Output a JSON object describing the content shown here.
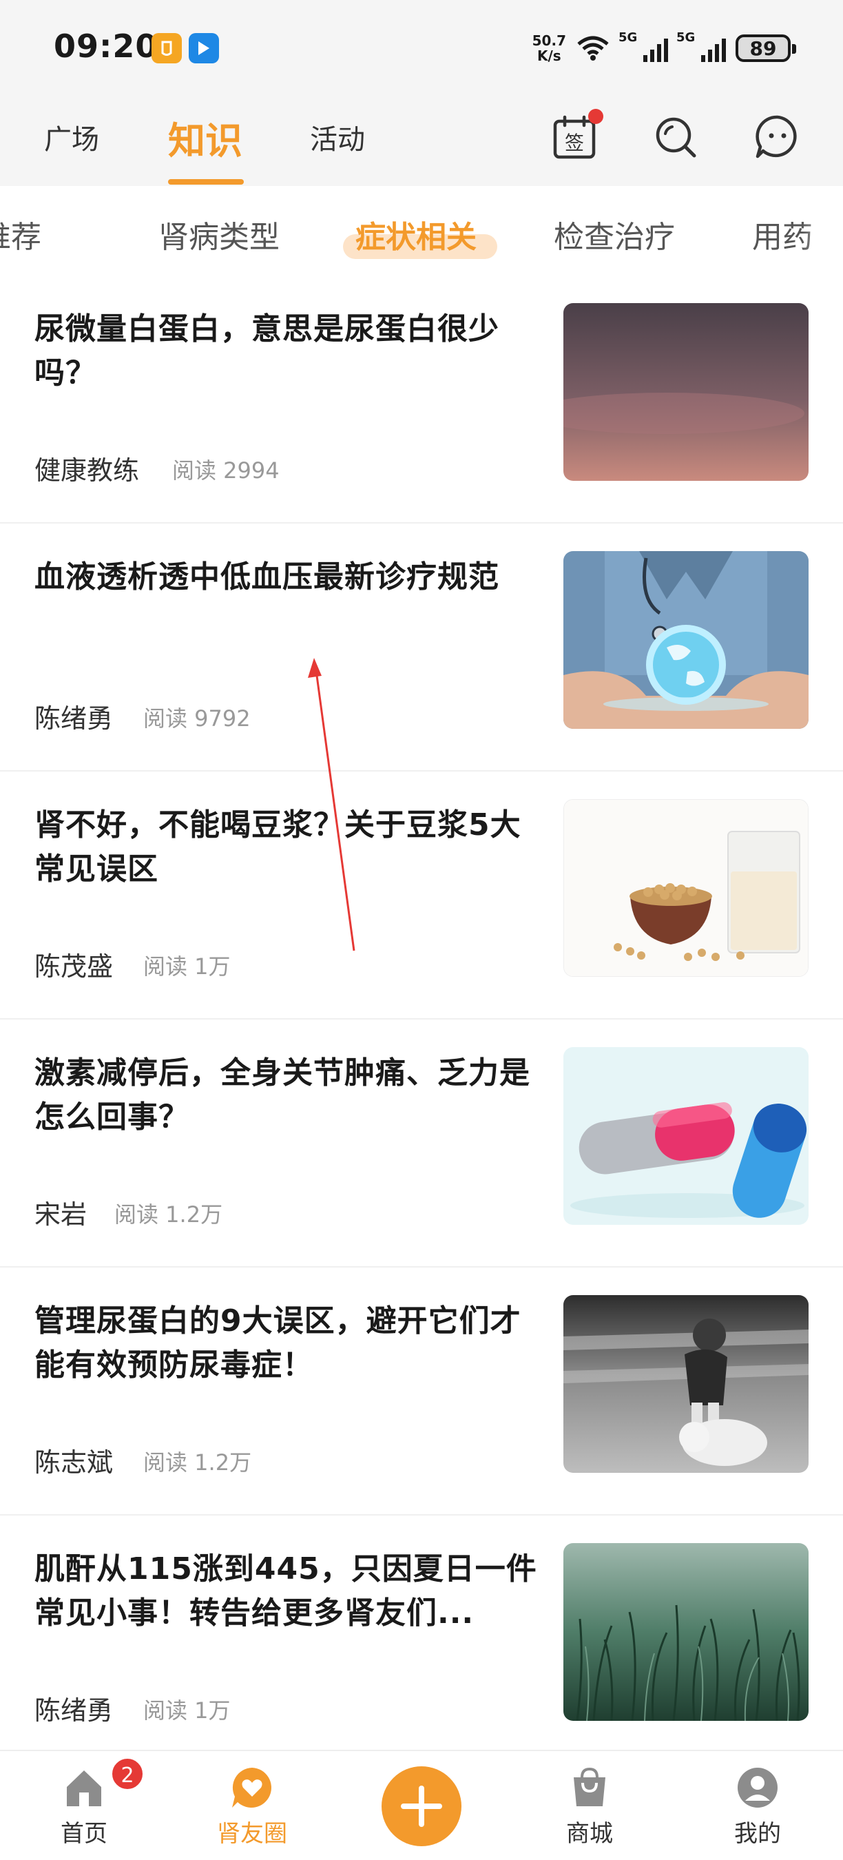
{
  "status_bar": {
    "time": "09:20",
    "net_speed_value": "50.7",
    "net_speed_unit": "K/s",
    "signal1_label": "5G",
    "signal2_label": "5G",
    "battery": "89"
  },
  "top_nav": {
    "tabs": [
      {
        "label": "广场"
      },
      {
        "label": "知识"
      },
      {
        "label": "活动"
      }
    ],
    "active_tab": "知识",
    "sign_icon_text": "签",
    "accent_color": "#f39a2c"
  },
  "category_tabs": {
    "items": [
      {
        "label": "推荐"
      },
      {
        "label": "肾病类型"
      },
      {
        "label": "症状相关"
      },
      {
        "label": "检查治疗"
      },
      {
        "label": "用药"
      }
    ],
    "active": "症状相关"
  },
  "articles": [
    {
      "title": "尿微量白蛋白，意思是尿蛋白很少吗？",
      "author": "健康教练",
      "reads": "阅读 2994",
      "image": "crescent-moon-dusk"
    },
    {
      "title": "血液透析透中低血压最新诊疗规范",
      "author": "陈绪勇",
      "reads": "阅读 9792",
      "image": "doctor-holding-globe"
    },
    {
      "title": "肾不好，不能喝豆浆？关于豆浆5大常见误区",
      "author": "陈茂盛",
      "reads": "阅读 1万",
      "image": "soybeans-and-soymilk"
    },
    {
      "title": "激素减停后，全身关节肿痛、乏力是怎么回事？",
      "author": "宋岩",
      "reads": "阅读 1.2万",
      "image": "medicine-capsules"
    },
    {
      "title": "管理尿蛋白的9大误区，避开它们才能有效预防尿毒症！",
      "author": "陈志斌",
      "reads": "阅读 1.2万",
      "image": "girl-with-dog-bw"
    },
    {
      "title": "肌酐从115涨到445，只因夏日一件常见小事！转告给更多肾友们...",
      "author": "陈绪勇",
      "reads": "阅读 1万",
      "image": "green-grass"
    }
  ],
  "bottom_nav": {
    "items": [
      {
        "label": "首页",
        "icon": "home-icon",
        "badge": "2"
      },
      {
        "label": "肾友圈",
        "icon": "heart-chat-icon"
      },
      {
        "label": "",
        "icon": "plus-icon"
      },
      {
        "label": "商城",
        "icon": "shopping-bag-icon"
      },
      {
        "label": "我的",
        "icon": "profile-icon"
      }
    ],
    "active": "肾友圈"
  }
}
